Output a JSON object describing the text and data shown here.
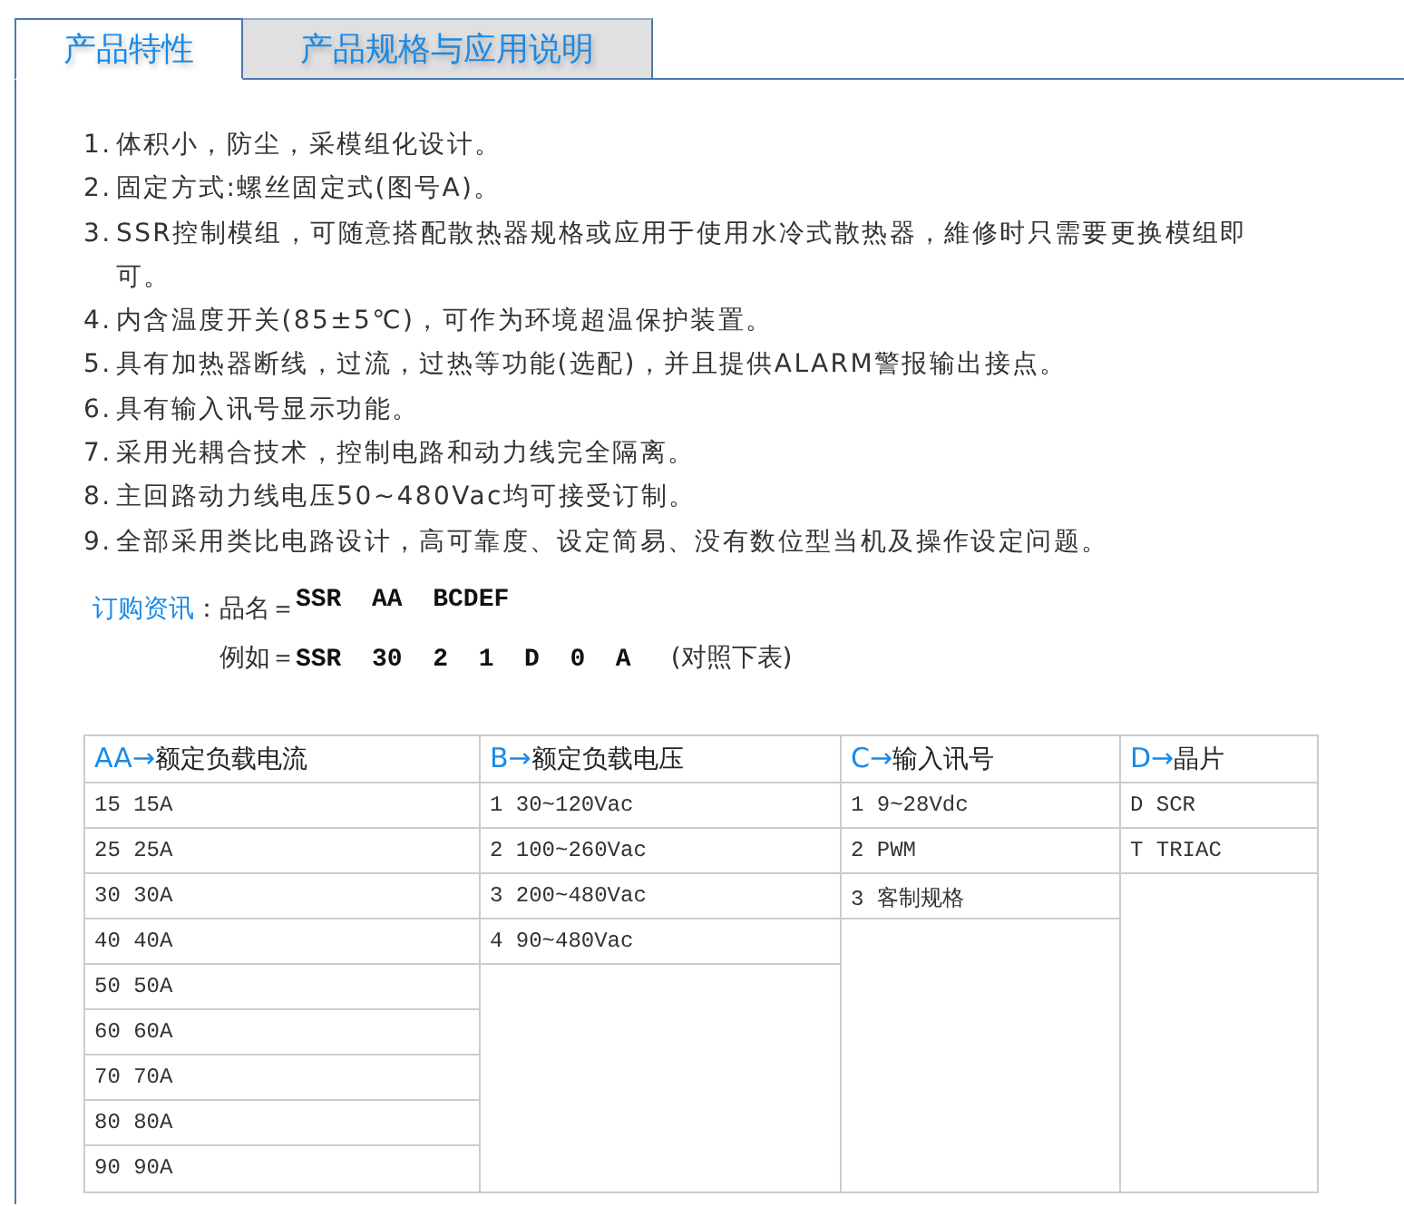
{
  "tabs": [
    {
      "label": "产品特性",
      "selected": true
    },
    {
      "label": "产品规格与应用说明",
      "selected": false
    }
  ],
  "features": [
    {
      "number": "1.",
      "text": "体积小，防尘，采模组化设计。"
    },
    {
      "number": "2.",
      "text": "固定方式:螺丝固定式(图号A)。"
    },
    {
      "number": "3.",
      "text": "SSR控制模组，可随意搭配散热器规格或应用于使用水冷式散热器，維修时只需要更换模组即可。"
    },
    {
      "number": "4.",
      "text": "内含温度开关(85±5℃)，可作为环境超温保护装置。"
    },
    {
      "number": "5.",
      "text": "具有加热器断线，过流，过热等功能(选配)，并且提供ALARM警报输出接点。"
    },
    {
      "number": "6.",
      "text": "具有输入讯号显示功能。"
    },
    {
      "number": "7.",
      "text": "采用光耦合技术，控制电路和动力线完全隔离。"
    },
    {
      "number": "8.",
      "text": "主回路动力线电压50~480Vac均可接受订制。"
    },
    {
      "number": "9.",
      "text": "全部采用类比电路设计，高可靠度、设定简易、没有数位型当机及操作设定问题。"
    }
  ],
  "order_info": {
    "label": "订购资讯",
    "separator": "：",
    "lines": [
      {
        "prefix": "品名＝",
        "code": "SSR  AA  BCDEF"
      },
      {
        "prefix": "例如＝",
        "code": "SSR  30  2  1  D  0  A",
        "note": "(对照下表)"
      }
    ]
  },
  "table": {
    "columns": [
      {
        "code": "AA→",
        "label": "额定负载电流",
        "cells": [
          "15 15A",
          "25 25A",
          "30 30A",
          "40 40A",
          "50 50A",
          "60 60A",
          "70 70A",
          "80 80A",
          "90 90A"
        ]
      },
      {
        "code": "B→",
        "label": "额定负载电压",
        "cells": [
          "1 30~120Vac",
          "2 100~260Vac",
          "3 200~480Vac",
          "4 90~480Vac"
        ]
      },
      {
        "code": "C→",
        "label": "输入讯号",
        "cells": [
          "1 9~28Vdc",
          "2 PWM",
          "3 客制规格"
        ]
      },
      {
        "code": "D→",
        "label": "晶片",
        "cells": [
          "D SCR",
          "T TRIAC"
        ]
      }
    ]
  }
}
